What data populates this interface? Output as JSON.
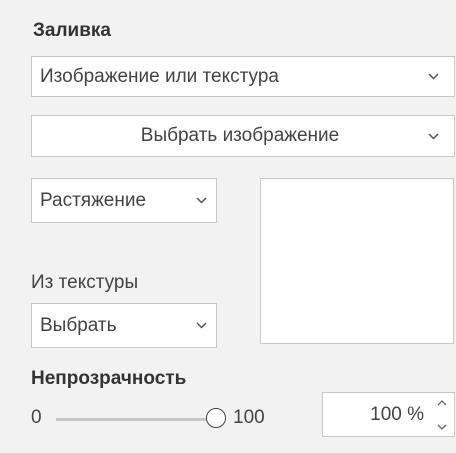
{
  "fill": {
    "heading": "Заливка",
    "type_value": "Изображение или текстура",
    "image_button": "Выбрать изображение",
    "stretch_value": "Растяжение",
    "texture_label": "Из текстуры",
    "texture_value": "Выбрать"
  },
  "opacity": {
    "heading": "Непрозрачность",
    "slider_min": "0",
    "slider_max": "100",
    "slider_value": 100,
    "spin_value": "100 %"
  },
  "icons": {
    "dropdown": "chevron-down-icon",
    "spin_up": "chevron-up-icon",
    "spin_down": "chevron-down-icon"
  },
  "colors": {
    "panel_background": "#f2f2f2",
    "control_background": "#ffffff",
    "control_border": "#c8c8c8",
    "text": "#444444"
  }
}
